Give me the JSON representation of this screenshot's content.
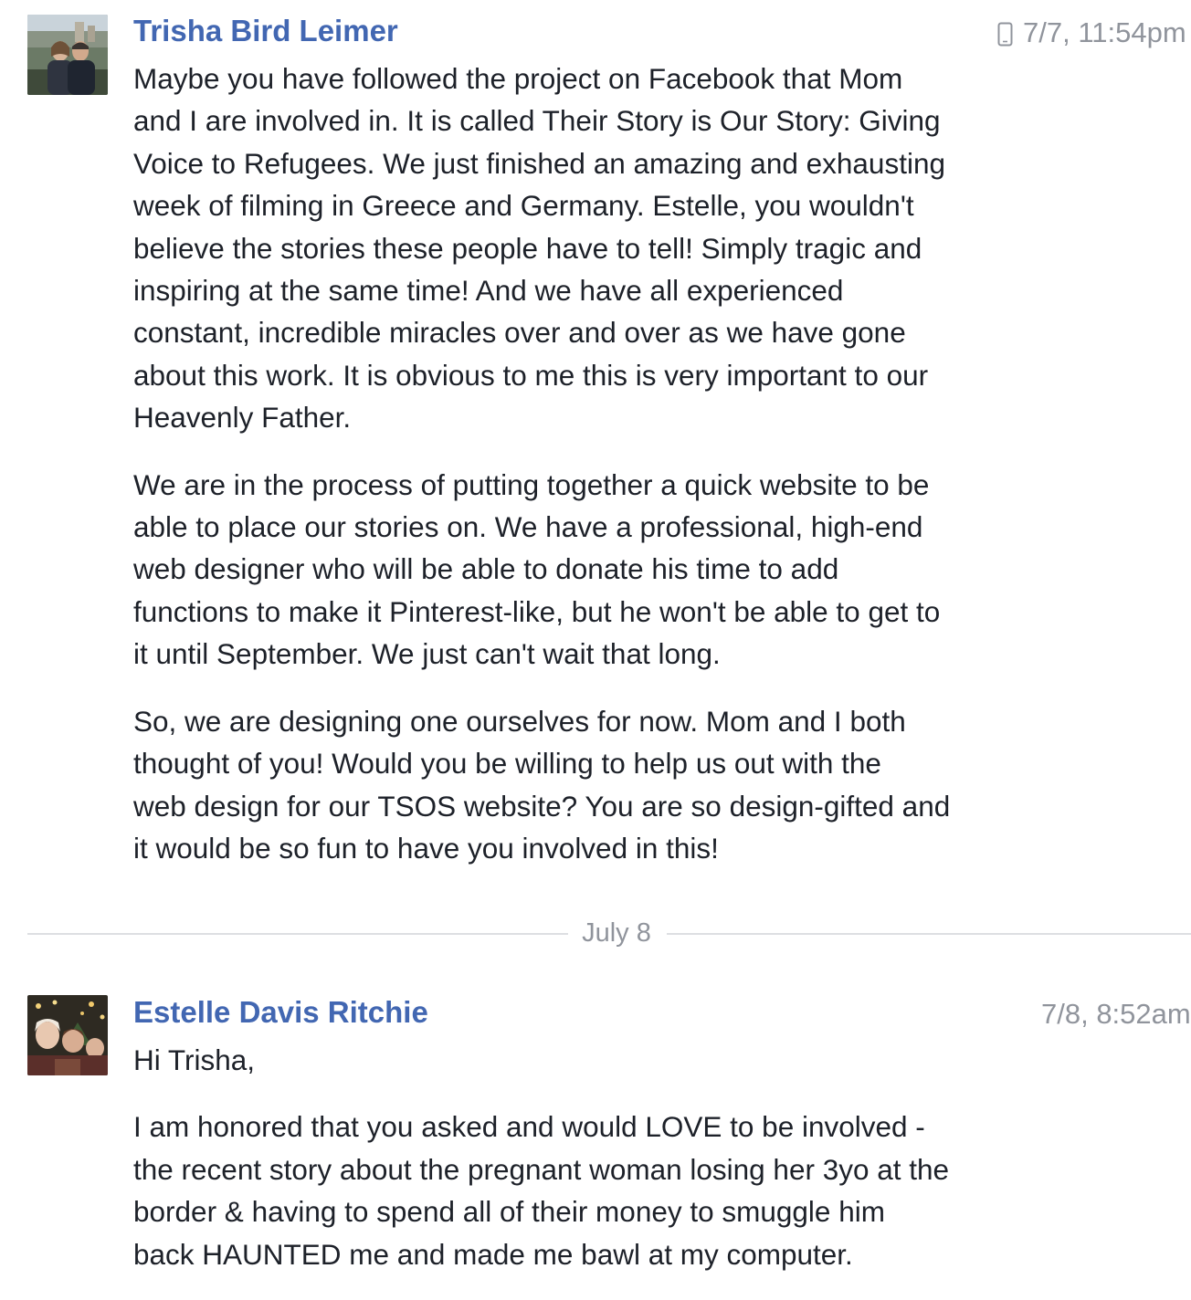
{
  "messages": [
    {
      "sender": "Trisha Bird Leimer",
      "timestamp": "7/7, 11:54pm",
      "sent_from_mobile": true,
      "avatar_icon": "profile-photo",
      "paragraphs": [
        "Maybe you have followed the project on Facebook that Mom\nand I are involved in. It is called Their Story is Our Story: Giving\nVoice to Refugees. We just finished an amazing and exhausting\nweek of filming in Greece and Germany. Estelle, you wouldn't\nbelieve the stories these people have to tell!  Simply tragic and\ninspiring at the same time!  And we have all experienced\nconstant, incredible miracles over and over as we have gone\nabout this work. It is obvious to me this is very important to our\nHeavenly Father.",
        "We are in the process of putting together a quick website to be\nable to place our stories on. We have a professional, high-end\nweb designer who will be able to donate his time to add\nfunctions to make it Pinterest-like, but he won't be able to get to\nit until September.  We just can't wait that long.",
        "So, we are designing one ourselves for now. Mom and I both\nthought of you!  Would you be willing to help us out with the\nweb design for our TSOS website?  You are so design-gifted and\nit would be so fun to have you involved in this!"
      ]
    },
    {
      "sender": "Estelle Davis Ritchie",
      "timestamp": "7/8, 8:52am",
      "sent_from_mobile": false,
      "avatar_icon": "profile-photo",
      "paragraphs": [
        "Hi Trisha,",
        "I am honored that you asked and would LOVE to be involved -\nthe recent story about the pregnant woman losing her 3yo at the\nborder & having to spend all of their money to smuggle him\nback HAUNTED me and made me bawl at my computer."
      ]
    }
  ],
  "date_divider": "July 8",
  "colors": {
    "sender_name": "#4267b2",
    "timestamp": "#90949c",
    "body_text": "#1d2129",
    "divider": "#dddfe2"
  }
}
